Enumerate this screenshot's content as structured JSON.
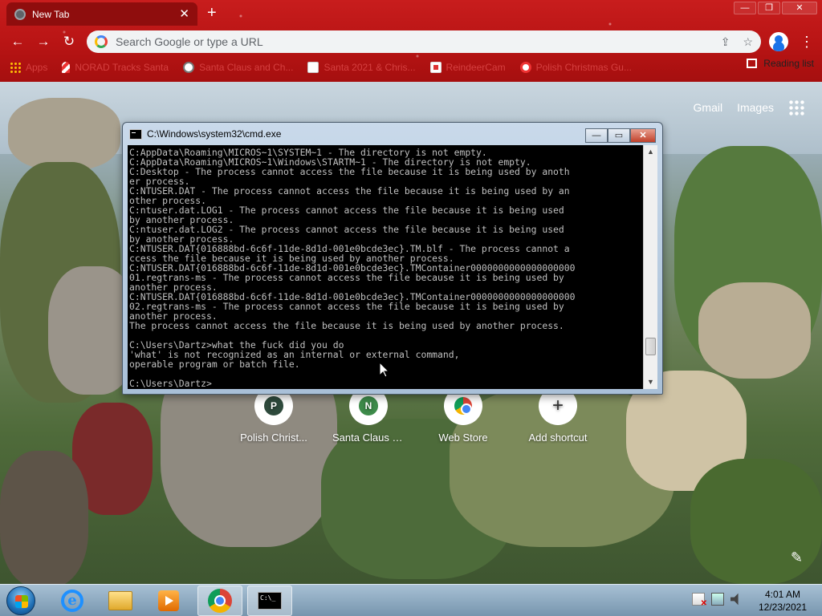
{
  "browser": {
    "tab_title": "New Tab",
    "omnibox_placeholder": "Search Google or type a URL",
    "bookmarks": [
      {
        "label": "Apps",
        "icon": "apps-grid-icon",
        "cls": "bm-apps"
      },
      {
        "label": "NORAD Tracks Santa",
        "icon": "candy-cane-icon",
        "cls": "bm-cane"
      },
      {
        "label": "Santa Claus and Ch...",
        "icon": "globe-icon",
        "cls": "bm-globe"
      },
      {
        "label": "Santa 2021 & Chris...",
        "icon": "image-icon",
        "cls": "bm-img"
      },
      {
        "label": "ReindeerCam",
        "icon": "reindeer-icon",
        "cls": "bm-red"
      },
      {
        "label": "Polish Christmas Gu...",
        "icon": "polish-icon",
        "cls": "bm-polish"
      }
    ],
    "reading_list": "Reading list"
  },
  "ntp": {
    "gmail": "Gmail",
    "images": "Images",
    "shortcuts": [
      {
        "letter": "P",
        "label": "Polish Christ...",
        "color": "#2e4a3c"
      },
      {
        "letter": "N",
        "label": "Santa Claus a...",
        "color": "#3d8b4a"
      },
      {
        "letter": "",
        "label": "Web Store",
        "color": "chrome"
      },
      {
        "letter": "+",
        "label": "Add shortcut",
        "color": "add"
      }
    ]
  },
  "cmd": {
    "title": "C:\\Windows\\system32\\cmd.exe",
    "lines": [
      "C:AppData\\Roaming\\MICROS~1\\SYSTEM~1 - The directory is not empty.",
      "C:AppData\\Roaming\\MICROS~1\\Windows\\STARTM~1 - The directory is not empty.",
      "C:Desktop - The process cannot access the file because it is being used by anoth",
      "er process.",
      "C:NTUSER.DAT - The process cannot access the file because it is being used by an",
      "other process.",
      "C:ntuser.dat.LOG1 - The process cannot access the file because it is being used",
      "by another process.",
      "C:ntuser.dat.LOG2 - The process cannot access the file because it is being used",
      "by another process.",
      "C:NTUSER.DAT{016888bd-6c6f-11de-8d1d-001e0bcde3ec}.TM.blf - The process cannot a",
      "ccess the file because it is being used by another process.",
      "C:NTUSER.DAT{016888bd-6c6f-11de-8d1d-001e0bcde3ec}.TMContainer0000000000000000000",
      "01.regtrans-ms - The process cannot access the file because it is being used by",
      "another process.",
      "C:NTUSER.DAT{016888bd-6c6f-11de-8d1d-001e0bcde3ec}.TMContainer0000000000000000000",
      "02.regtrans-ms - The process cannot access the file because it is being used by",
      "another process.",
      "The process cannot access the file because it is being used by another process.",
      "",
      "C:\\Users\\Dartz>what the fuck did you do",
      "'what' is not recognized as an internal or external command,",
      "operable program or batch file.",
      "",
      "C:\\Users\\Dartz>"
    ]
  },
  "taskbar": {
    "time": "4:01 AM",
    "date": "12/23/2021",
    "cmd_icon_text": "C:\\_"
  }
}
